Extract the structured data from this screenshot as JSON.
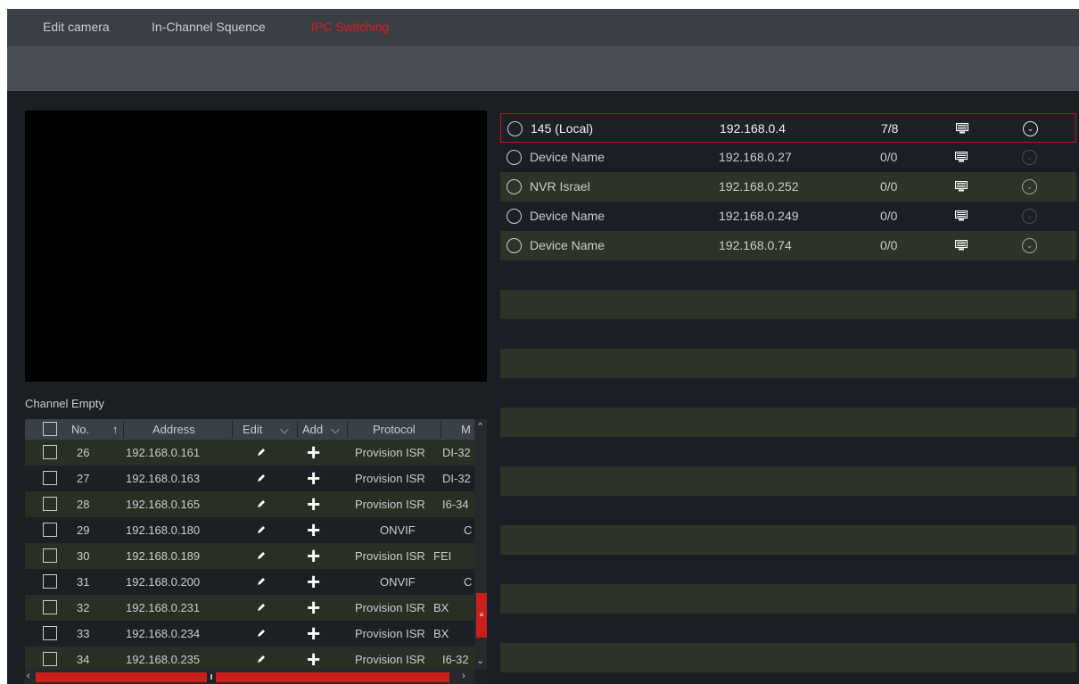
{
  "tabs": [
    {
      "label": "Edit camera"
    },
    {
      "label": "In-Channel Squence"
    },
    {
      "label": "IPC Switching"
    }
  ],
  "channel_label": "Channel Empty",
  "camera_table": {
    "columns": [
      "No.",
      "Address",
      "Edit",
      "Add",
      "Protocol",
      "M"
    ],
    "rows": [
      {
        "no": "26",
        "address": "192.168.0.161",
        "protocol": "Provision ISR",
        "model": "DI-32"
      },
      {
        "no": "27",
        "address": "192.168.0.163",
        "protocol": "Provision ISR",
        "model": "DI-32"
      },
      {
        "no": "28",
        "address": "192.168.0.165",
        "protocol": "Provision ISR",
        "model": "I6-34"
      },
      {
        "no": "29",
        "address": "192.168.0.180",
        "protocol": "ONVIF",
        "model": "C"
      },
      {
        "no": "30",
        "address": "192.168.0.189",
        "protocol": "Provision ISR",
        "model": "FEI"
      },
      {
        "no": "31",
        "address": "192.168.0.200",
        "protocol": "ONVIF",
        "model": "C"
      },
      {
        "no": "32",
        "address": "192.168.0.231",
        "protocol": "Provision ISR",
        "model": "BX"
      },
      {
        "no": "33",
        "address": "192.168.0.234",
        "protocol": "Provision ISR",
        "model": "BX"
      },
      {
        "no": "34",
        "address": "192.168.0.235",
        "protocol": "Provision ISR",
        "model": "I6-32"
      }
    ]
  },
  "device_list": [
    {
      "name": "145 (Local)",
      "ip": "192.168.0.4",
      "channels": "7/8"
    },
    {
      "name": "Device Name",
      "ip": "192.168.0.27",
      "channels": "0/0"
    },
    {
      "name": "NVR Israel",
      "ip": "192.168.0.252",
      "channels": "0/0"
    },
    {
      "name": "Device Name",
      "ip": "192.168.0.249",
      "channels": "0/0"
    },
    {
      "name": "Device Name",
      "ip": "192.168.0.74",
      "channels": "0/0"
    }
  ],
  "colors": {
    "accent": "#c9201c",
    "background": "#1b1f24",
    "header": "#3a3f45"
  },
  "icons": {
    "edit": "pencil-icon",
    "add": "plus-icon",
    "monitor": "monitor-icon",
    "expand": "chevron-down-circle-icon",
    "sort": "arrow-up-icon"
  }
}
